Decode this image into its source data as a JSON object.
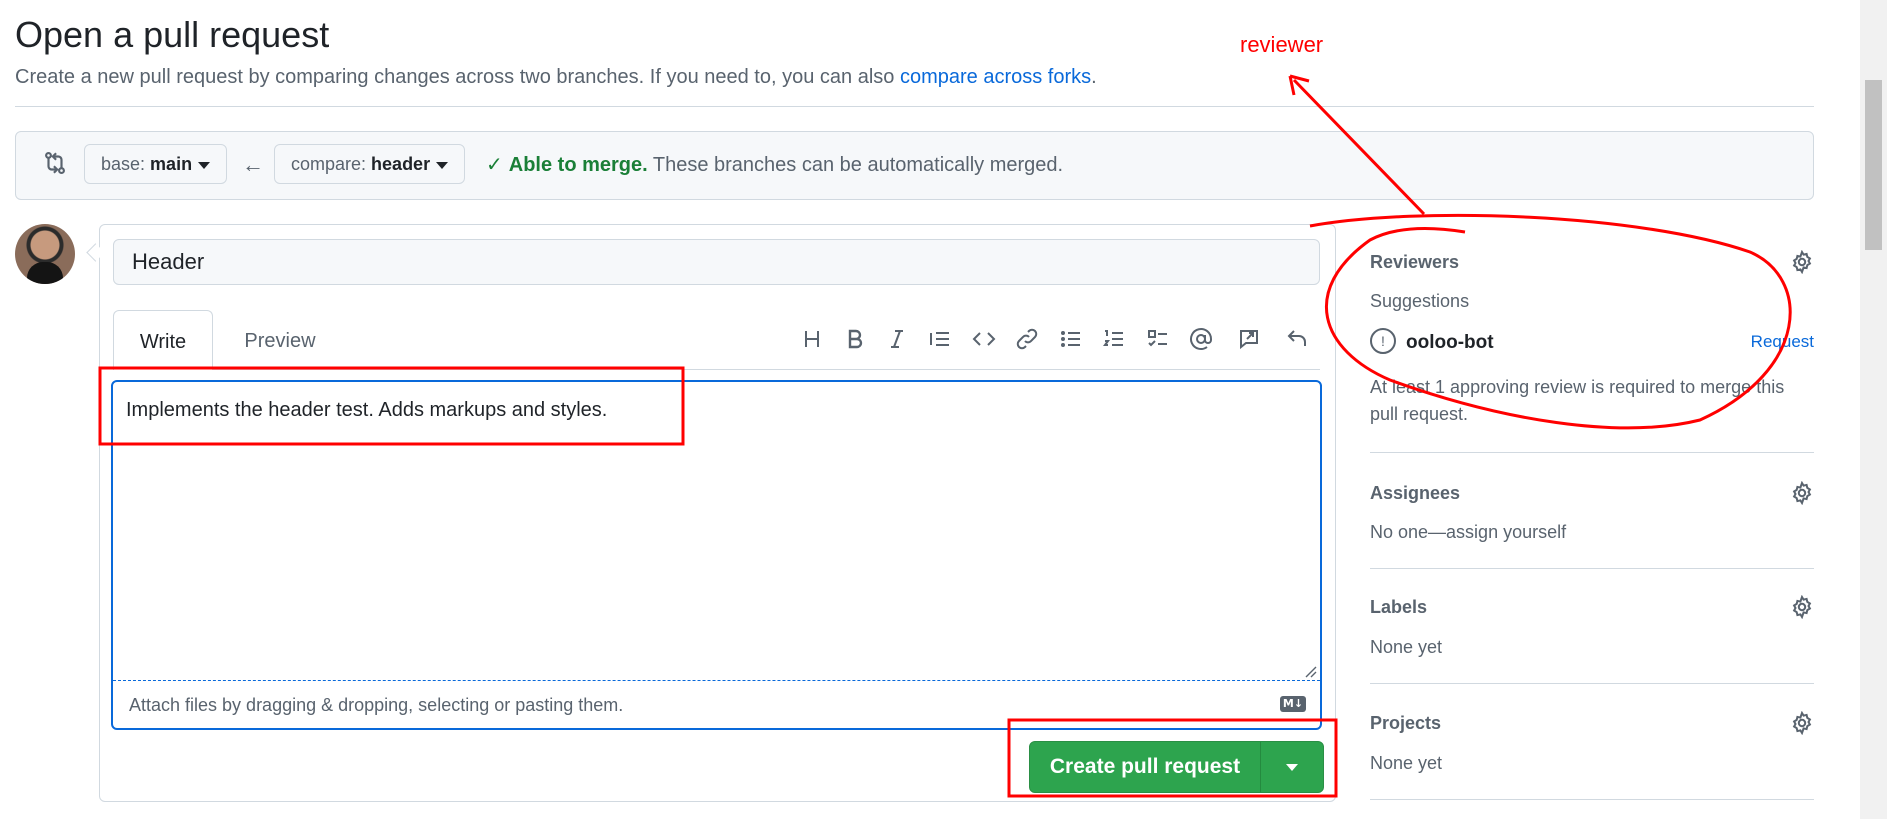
{
  "page": {
    "title": "Open a pull request",
    "subtitle_prefix": "Create a new pull request by comparing changes across two branches. If you need to, you can also ",
    "subtitle_link": "compare across forks",
    "subtitle_suffix": "."
  },
  "compare": {
    "base_prefix": "base: ",
    "base_branch": "main",
    "compare_prefix": "compare: ",
    "compare_branch": "header",
    "status_strong": "Able to merge.",
    "status_text": " These branches can be automatically merged."
  },
  "editor": {
    "title_value": "Header",
    "tabs": [
      {
        "label": "Write"
      },
      {
        "label": "Preview"
      }
    ],
    "body_value": "Implements the header test. Adds markups and styles.",
    "attach_hint": "Attach files by dragging & dropping, selecting or pasting them.",
    "markdown_badge": "M↓",
    "submit_label": "Create pull request"
  },
  "sidebar": {
    "reviewers": {
      "heading": "Reviewers",
      "suggestions_label": "Suggestions",
      "suggested_user": "ooloo-bot",
      "request_label": "Request",
      "note_line1": "At least 1 approving review is required to merge this",
      "note_line2": "pull request."
    },
    "assignees": {
      "heading": "Assignees",
      "prefix": "No one—",
      "action": "assign yourself"
    },
    "labels": {
      "heading": "Labels",
      "value": "None yet"
    },
    "projects": {
      "heading": "Projects",
      "value": "None yet"
    }
  },
  "annotation": {
    "label": "reviewer"
  },
  "colors": {
    "accent_blue": "#0969da",
    "success_green": "#2da44e",
    "annotation_red": "#ff0000"
  }
}
